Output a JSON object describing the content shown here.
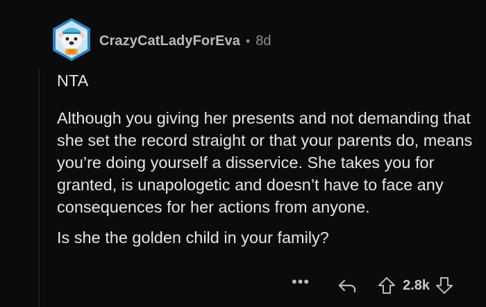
{
  "comment": {
    "author": "CrazyCatLadyForEva",
    "separator": "•",
    "age": "8d",
    "paragraphs": [
      "NTA",
      "Although you giving her presents and not demanding that she set the record straight or that your parents do, means you’re doing yourself a disservice. She takes you for granted, is unapologetic and doesn’t have to face any consequences for her actions from anyone.",
      "Is she the golden child in your family?"
    ],
    "actions": {
      "more_label": "•••",
      "score": "2.8k"
    },
    "icons": {
      "avatar": "koala-avatar-icon",
      "more": "more-options-icon",
      "reply": "reply-arrow-icon",
      "upvote": "upvote-arrow-icon",
      "downvote": "downvote-arrow-icon"
    },
    "colors": {
      "background": "#0b0b0b",
      "text": "#e3e5e6",
      "meta": "#8b9092",
      "avatar_frame": "#2d7fc1"
    }
  }
}
